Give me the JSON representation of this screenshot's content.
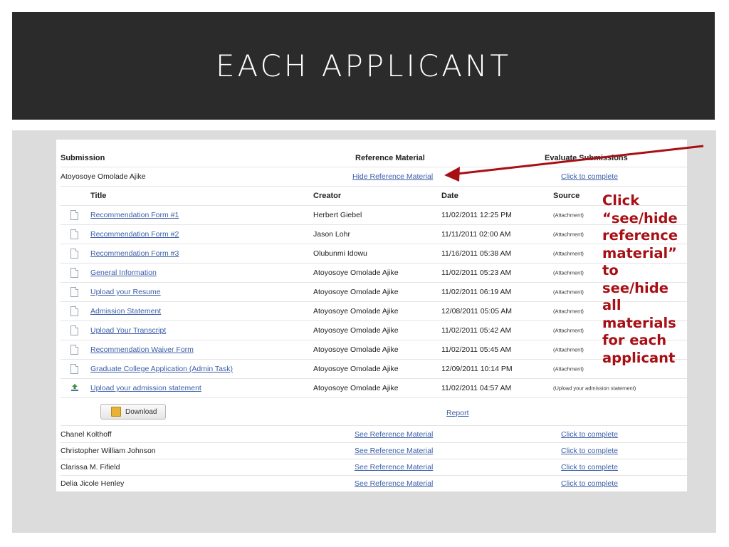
{
  "slide": {
    "title": "EACH APPLICANT",
    "annotation_lines": [
      "Click",
      "“see/hide",
      "reference",
      "material”",
      "to",
      "see/hide",
      "all",
      "materials",
      "for each",
      "applicant"
    ],
    "annotation_color": "#a80f15"
  },
  "table": {
    "headers": {
      "submission": "Submission",
      "reference": "Reference Material",
      "evaluate": "Evaluate Submissions"
    },
    "expanded_applicant": {
      "name": "Atoyosoye Omolade Ajike",
      "reference_link": "Hide Reference Material",
      "evaluate_link": "Click to complete"
    },
    "sub_headers": {
      "title": "Title",
      "creator": "Creator",
      "date": "Date",
      "source": "Source"
    },
    "materials": [
      {
        "icon": "document-icon",
        "title": "Recommendation Form #1",
        "creator": "Herbert Giebel",
        "date": "11/02/2011 12:25 PM",
        "source": "(Attachment)"
      },
      {
        "icon": "document-icon",
        "title": "Recommendation Form #2",
        "creator": "Jason Lohr",
        "date": "11/11/2011 02:00 AM",
        "source": "(Attachment)"
      },
      {
        "icon": "document-icon",
        "title": "Recommendation Form #3",
        "creator": "Olubunmi Idowu",
        "date": "11/16/2011 05:38 AM",
        "source": "(Attachment)"
      },
      {
        "icon": "document-icon",
        "title": "General Information",
        "creator": "Atoyosoye Omolade Ajike",
        "date": "11/02/2011 05:23 AM",
        "source": "(Attachment)"
      },
      {
        "icon": "document-icon",
        "title": "Upload your Resume",
        "creator": "Atoyosoye Omolade Ajike",
        "date": "11/02/2011 06:19 AM",
        "source": "(Attachment)"
      },
      {
        "icon": "document-icon",
        "title": "Admission Statement",
        "creator": "Atoyosoye Omolade Ajike",
        "date": "12/08/2011 05:05 AM",
        "source": "(Attachment)"
      },
      {
        "icon": "document-icon",
        "title": "Upload Your Transcript",
        "creator": "Atoyosoye Omolade Ajike",
        "date": "11/02/2011 05:42 AM",
        "source": "(Attachment)"
      },
      {
        "icon": "document-icon",
        "title": "Recommendation Waiver Form",
        "creator": "Atoyosoye Omolade Ajike",
        "date": "11/02/2011 05:45 AM",
        "source": "(Attachment)"
      },
      {
        "icon": "document-icon",
        "title": "Graduate College Application (Admin Task)",
        "creator": "Atoyosoye Omolade Ajike",
        "date": "12/09/2011 10:14 PM",
        "source": "(Attachment)"
      },
      {
        "icon": "download-upload-icon",
        "title": "Upload your admission statement",
        "creator": "Atoyosoye Omolade Ajike",
        "date": "11/02/2011 04:57 AM",
        "source": "(Upload your admission statement)"
      }
    ],
    "download_label": "Download",
    "report_label": "Report",
    "other_applicants": [
      {
        "name": "Chanel Kolthoff",
        "reference_link": "See Reference Material",
        "evaluate_link": "Click to complete"
      },
      {
        "name": "Christopher William Johnson",
        "reference_link": "See Reference Material",
        "evaluate_link": "Click to complete"
      },
      {
        "name": "Clarissa M. Fifield",
        "reference_link": "See Reference Material",
        "evaluate_link": "Click to complete"
      },
      {
        "name": "Delia Jicole Henley",
        "reference_link": "See Reference Material",
        "evaluate_link": "Click to complete"
      }
    ]
  }
}
